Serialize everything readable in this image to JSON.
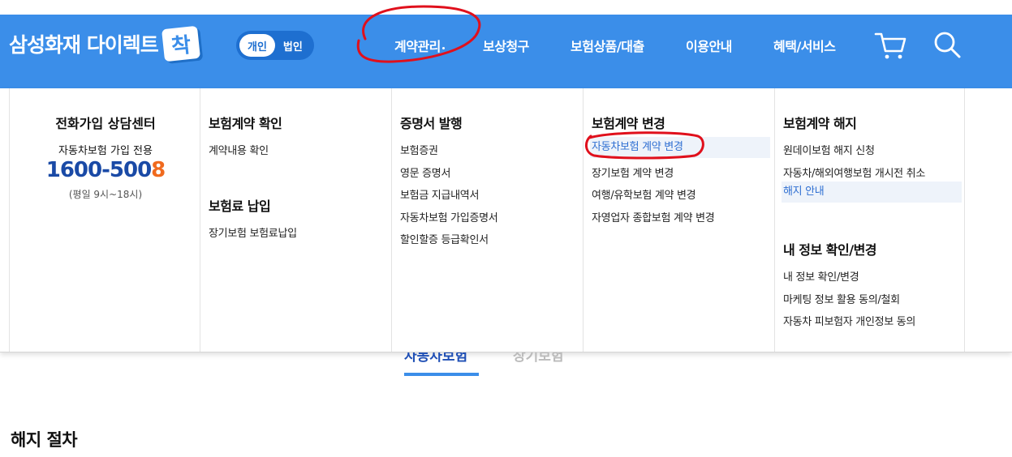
{
  "header": {
    "logo_text": "삼성화재 다이렉트",
    "logo_badge": "착",
    "toggle": {
      "personal": "개인",
      "corporate": "법인",
      "active": "개인"
    },
    "nav": [
      "계약관리",
      "보상청구",
      "보험상품/대출",
      "이용안내",
      "혜택/서비스"
    ],
    "icons": [
      "cart-icon",
      "search-icon"
    ],
    "brand_color": "#3b8ee9"
  },
  "dropdown": {
    "contact": {
      "title": "전화가입 상담센터",
      "subtitle": "자동차보험 가입 전용",
      "phone_main": "1600-500",
      "phone_last": "8",
      "hours": "(평일 9시~18시)"
    },
    "col2": {
      "section1": {
        "title": "보험계약 확인",
        "items": [
          "계약내용 확인"
        ]
      },
      "section2": {
        "title": "보험료 납입",
        "items": [
          "장기보험 보험료납입"
        ]
      }
    },
    "col3": {
      "section1": {
        "title": "증명서 발행",
        "items": [
          "보험증권",
          "영문 증명서",
          "보험금 지급내역서",
          "자동차보험 가입증명서",
          "할인할증 등급확인서"
        ]
      }
    },
    "col4": {
      "section1": {
        "title": "보험계약 변경",
        "items": [
          "자동차보험 계약 변경",
          "장기보험 계약 변경",
          "여행/유학보험 계약 변경",
          "자영업자 종합보험 계약 변경"
        ]
      }
    },
    "col5": {
      "section1": {
        "title": "보험계약 해지",
        "items": [
          "원데이보험 해지 신청",
          "자동차/해외여행보험 개시전 취소",
          "해지 안내"
        ]
      },
      "section2": {
        "title": "내 정보 확인/변경",
        "items": [
          "내 정보 확인/변경",
          "마케팅 정보 활용 동의/철회",
          "자동차 피보험자 개인정보 동의"
        ]
      }
    }
  },
  "tabs": [
    "자동차보험",
    "장기보험"
  ],
  "main": {
    "heading": "해지 절차"
  }
}
